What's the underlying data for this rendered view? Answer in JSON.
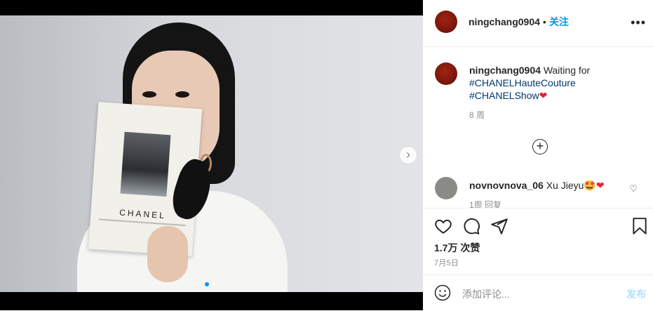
{
  "post": {
    "username": "ningchang0904",
    "follow_label": "关注",
    "bullet": "•",
    "more_icon": "more-horizontal-icon"
  },
  "caption": {
    "username": "ningchang0904",
    "text": "Waiting for",
    "hashtag1": "#CHANELHauteCouture",
    "hashtag2": "#CHANELShow",
    "heart": "❤",
    "time": "8 周"
  },
  "comment": {
    "username": "novnovnova_06",
    "text": "Xu Jieyu",
    "emoji": "🤩",
    "heart": "❤",
    "meta": "1周  回复"
  },
  "photo": {
    "booklet_brand": "CHANEL"
  },
  "stats": {
    "likes": "1.7万 次赞",
    "date": "7月5日"
  },
  "composer": {
    "placeholder": "添加评论...",
    "post_label": "发布"
  },
  "carousel": {
    "current": 1,
    "total": 2
  },
  "colors": {
    "accent": "#0095f6",
    "hashtag": "#00376b",
    "heart": "#ed1f2f",
    "post_disabled": "#b2dffc"
  }
}
